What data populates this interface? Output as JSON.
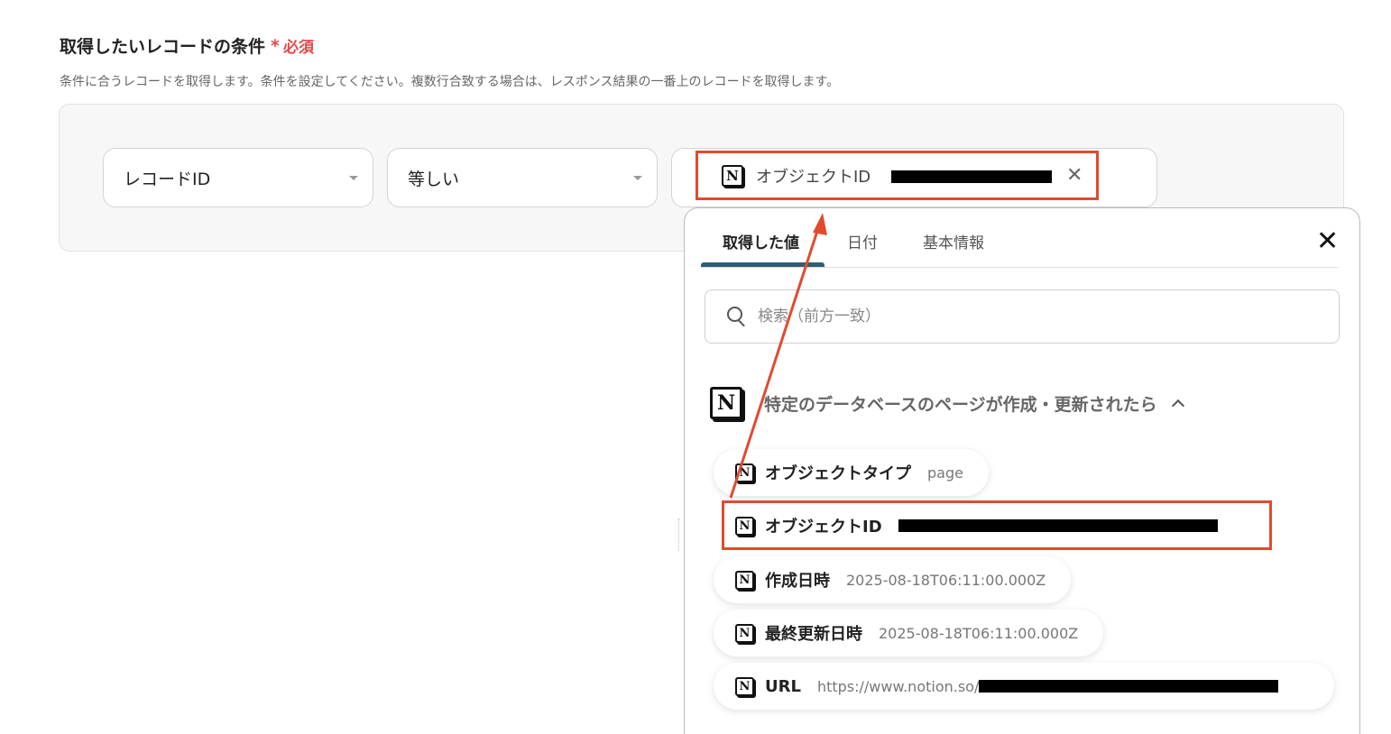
{
  "section": {
    "title": "取得したいレコードの条件",
    "required_mark": "*",
    "required_text": "必須",
    "description": "条件に合うレコードを取得します。条件を設定してください。複数行合致する場合は、レスポンス結果の一番上のレコードを取得します。"
  },
  "condition": {
    "field": "レコードID",
    "operator": "等しい",
    "value_chip": {
      "label": "オブジェクトID"
    }
  },
  "panel": {
    "tabs": [
      {
        "label": "取得した値"
      },
      {
        "label": "日付"
      },
      {
        "label": "基本情報"
      }
    ],
    "search_placeholder": "検索（前方一致）",
    "group": {
      "title": "特定のデータベースのページが作成・更新されたら",
      "items": [
        {
          "label": "オブジェクトタイプ",
          "value": "page"
        },
        {
          "label": "オブジェクトID",
          "value": ""
        },
        {
          "label": "作成日時",
          "value": "2025-08-18T06:11:00.000Z"
        },
        {
          "label": "最終更新日時",
          "value": "2025-08-18T06:11:00.000Z"
        },
        {
          "label": "URL",
          "value": "https://www.notion.so/"
        }
      ]
    }
  },
  "colors": {
    "required": "#e24a4a",
    "highlight": "#e04b30",
    "tab_indicator": "#2f5d73"
  },
  "icons": {
    "notion": "notion-icon",
    "close": "close-icon",
    "search": "search-icon",
    "chevron": "chevron-up-icon",
    "dropdown": "dropdown-caret-icon"
  }
}
